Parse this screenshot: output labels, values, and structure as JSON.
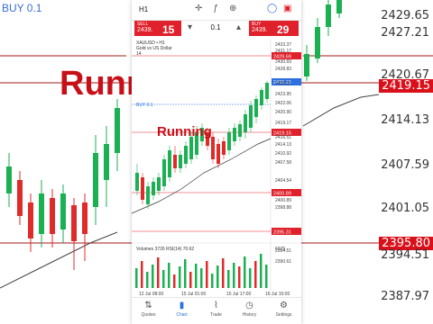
{
  "background": {
    "buy_label": "BUY 0.1",
    "running_text": "Running",
    "price_axis": [
      "2429.65",
      "2427.21",
      "2420.67",
      "2419.15",
      "2414.13",
      "2407.59",
      "2401.05",
      "2395.80",
      "2394.51",
      "2387.97"
    ]
  },
  "topbar": {
    "timeframe": "H1",
    "icons": [
      "crosshair-icon",
      "function-icon",
      "objects-icon",
      "circle-icon",
      "flag-icon"
    ]
  },
  "trade": {
    "sell_label": "SELL",
    "sell_small": "2439.",
    "sell_big": "15",
    "buy_label": "BUY",
    "buy_small": "2439.",
    "buy_big": "29",
    "lot": "0.1"
  },
  "chart": {
    "symbol_line1": "XAUUSD • H1",
    "symbol_line2": "Gold vs US Dollar",
    "symbol_line3": "14",
    "buy_line_label": "BUY 0.1",
    "running_text": "Running",
    "volumes_label": "Volumes 3726 RSI(14) 70.62",
    "price_labels": [
      "2433.37",
      "2431.17",
      "2430.69",
      "2428.83",
      "2426.15",
      "2423.95",
      "2422.06",
      "2420.90",
      "2419.17",
      "2416.51",
      "2414.13",
      "2410.92",
      "2407.58",
      "2404.54",
      "2400.89",
      "2398.88",
      "2394.51",
      "2390.61"
    ],
    "red_tags": [
      "2429.69",
      "2419.15",
      "2400.89",
      "2395.31"
    ],
    "current_price": "2439.15",
    "vol_scale": "6975",
    "x_labels": [
      "12 Jul 08:00",
      "15 Jul 01:00",
      "15 Jul 17:00",
      "16 Jul 10:00"
    ],
    "colors": {
      "bull": "#1bb052",
      "bear": "#e02b2b",
      "accent": "#2c6fe0",
      "alert": "#e0202a"
    }
  },
  "nav": [
    {
      "icon": "quotes-icon",
      "label": "Quotes",
      "active": false,
      "glyph": "⇅"
    },
    {
      "icon": "chart-icon",
      "label": "Chart",
      "active": true,
      "glyph": "▮"
    },
    {
      "icon": "trade-icon",
      "label": "Trade",
      "active": false,
      "glyph": "⌇"
    },
    {
      "icon": "history-icon",
      "label": "History",
      "active": false,
      "glyph": "◷"
    },
    {
      "icon": "settings-icon",
      "label": "Settings",
      "active": false,
      "glyph": "⚙"
    }
  ]
}
